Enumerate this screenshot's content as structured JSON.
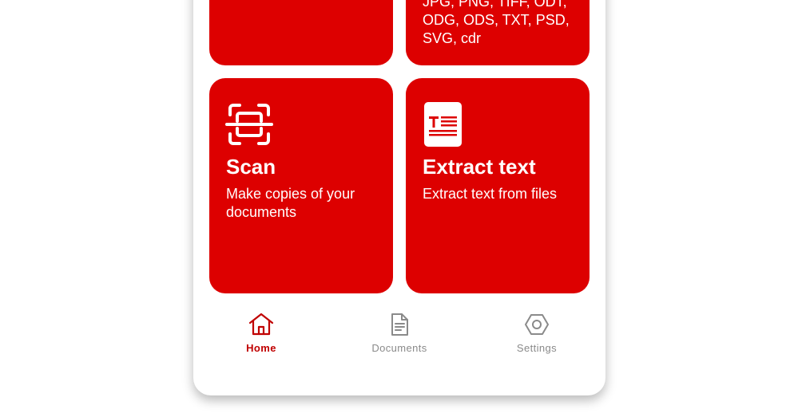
{
  "cards": {
    "convert": {
      "formats_text": "JPG, PNG, TIFF, ODT, ODG, ODS, TXT, PSD, SVG, cdr"
    },
    "scan": {
      "icon": "scan-icon",
      "title": "Scan",
      "description": "Make copies of your documents"
    },
    "extract": {
      "icon": "extract-text-icon",
      "title": "Extract text",
      "description": "Extract text from files"
    }
  },
  "nav": {
    "home": {
      "label": "Home",
      "icon": "home-icon",
      "active": true
    },
    "documents": {
      "label": "Documents",
      "icon": "document-icon"
    },
    "settings": {
      "label": "Settings",
      "icon": "settings-icon"
    }
  },
  "colors": {
    "accent": "#dd0000",
    "active_nav": "#c00000",
    "inactive_nav": "#8a8a8a",
    "background": "#ffffff"
  }
}
